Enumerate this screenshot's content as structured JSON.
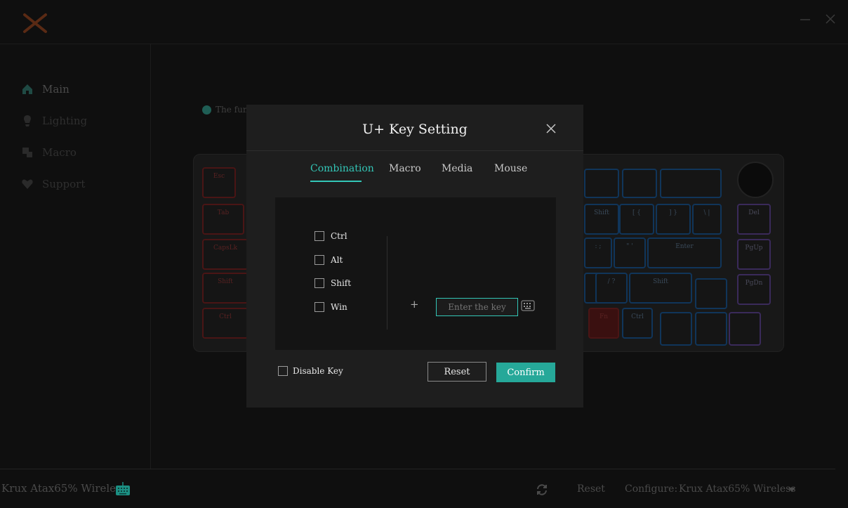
{
  "app": {
    "logo_icon": "x-logo-icon",
    "accent": "#33c6b7"
  },
  "sidebar": {
    "items": [
      {
        "label": "Main",
        "icon": "home-icon"
      },
      {
        "label": "Lighting",
        "icon": "bulb-icon"
      },
      {
        "label": "Macro",
        "icon": "macro-icon"
      },
      {
        "label": "Support",
        "icon": "heart-icon"
      }
    ]
  },
  "main": {
    "notice": "The func"
  },
  "keyboard": {
    "keys": [
      "Esc",
      "Tab",
      "CapsLk",
      "Shift",
      "Ctrl",
      "Fn",
      "Ctrl",
      "Del",
      "PgUp",
      "PgDn",
      "Enter",
      "Shift",
      "[ {",
      "] }",
      "\\ |",
      ": ;",
      "\" '",
      "/ ?"
    ]
  },
  "modal": {
    "title": "U+ Key Setting",
    "tabs": [
      "Combination",
      "Macro",
      "Media",
      "Mouse"
    ],
    "active_tab": "Combination",
    "modifiers": [
      "Ctrl",
      "Alt",
      "Shift",
      "Win"
    ],
    "plus": "+",
    "key_input_placeholder": "Enter the key",
    "disable_key_label": "Disable Key",
    "reset_label": "Reset",
    "confirm_label": "Confirm"
  },
  "footer": {
    "device_name": "Krux Atax65% Wireless",
    "reset_label": "Reset",
    "config_label": "Configure:",
    "config_value": "Krux Atax65% Wireless"
  }
}
